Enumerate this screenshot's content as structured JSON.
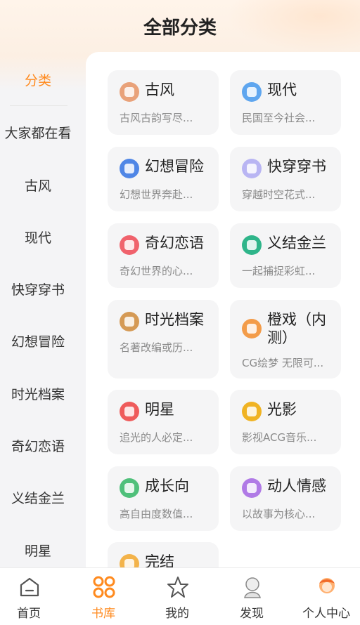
{
  "header": {
    "title": "全部分类"
  },
  "sidebar": {
    "items": [
      {
        "label": "分类",
        "active": true
      },
      {
        "label": "大家都在看"
      },
      {
        "label": "古风"
      },
      {
        "label": "现代"
      },
      {
        "label": "快穿穿书"
      },
      {
        "label": "幻想冒险"
      },
      {
        "label": "时光档案"
      },
      {
        "label": "奇幻恋语"
      },
      {
        "label": "义结金兰"
      },
      {
        "label": "明星"
      }
    ]
  },
  "categories": [
    {
      "title": "古风",
      "desc": "古风古韵写尽...",
      "icon": "fan-icon",
      "color": "#e9a27a"
    },
    {
      "title": "现代",
      "desc": "民国至今社会...",
      "icon": "city-icon",
      "color": "#5fa6ef"
    },
    {
      "title": "幻想冒险",
      "desc": "幻想世界奔赴...",
      "icon": "compass-icon",
      "color": "#4f86e6"
    },
    {
      "title": "快穿穿书",
      "desc": "穿越时空花式...",
      "icon": "book-icon",
      "color": "#b9b5f3"
    },
    {
      "title": "奇幻恋语",
      "desc": "奇幻世界的心...",
      "icon": "heart-icon",
      "color": "#f0626c"
    },
    {
      "title": "义结金兰",
      "desc": "一起捕捉彩虹...",
      "icon": "handshake-icon",
      "color": "#2fb58a"
    },
    {
      "title": "时光档案",
      "desc": "名著改编或历...",
      "icon": "hourglass-icon",
      "color": "#d59a55"
    },
    {
      "title": "橙戏（内测）",
      "desc": "CG绘梦 无限可...",
      "icon": "film-reel-icon",
      "color": "#f39c4a"
    },
    {
      "title": "明星",
      "desc": "追光的人必定...",
      "icon": "star-person-icon",
      "color": "#ef5b5b"
    },
    {
      "title": "光影",
      "desc": "影视ACG音乐...",
      "icon": "light-icon",
      "color": "#f0b323"
    },
    {
      "title": "成长向",
      "desc": "高自由度数值...",
      "icon": "sprout-icon",
      "color": "#4fc07a"
    },
    {
      "title": "动人情感",
      "desc": "以故事为核心...",
      "icon": "smile-icon",
      "color": "#b07ae6"
    },
    {
      "title": "完结",
      "desc": "",
      "icon": "stack-icon",
      "color": "#f3b34a"
    }
  ],
  "tabbar": {
    "items": [
      {
        "label": "首页",
        "icon": "home-icon"
      },
      {
        "label": "书库",
        "icon": "library-grid-icon",
        "active": true
      },
      {
        "label": "我的",
        "icon": "star-outline-icon"
      },
      {
        "label": "发现",
        "icon": "character-avatar-icon"
      },
      {
        "label": "个人中心",
        "icon": "user-avatar-icon"
      }
    ]
  },
  "colors": {
    "accent": "#ff8a1e",
    "card_bg": "#f5f5f6",
    "desc_text": "#8a8a8a"
  }
}
